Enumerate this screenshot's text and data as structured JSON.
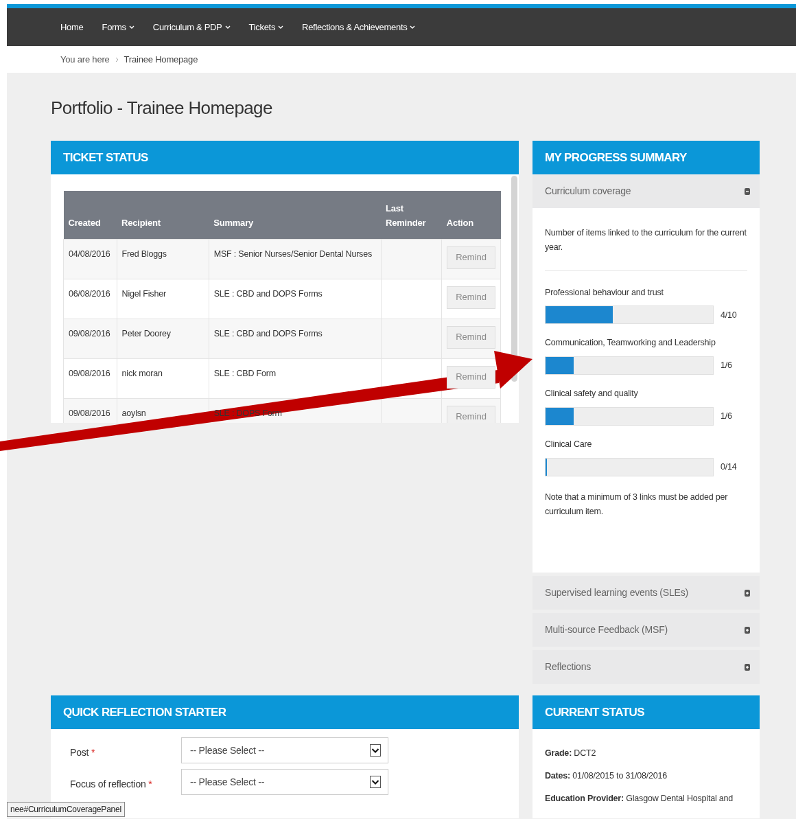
{
  "nav": {
    "items": [
      {
        "label": "Home",
        "dropdown": false
      },
      {
        "label": "Forms",
        "dropdown": true
      },
      {
        "label": "Curriculum & PDP",
        "dropdown": true
      },
      {
        "label": "Tickets",
        "dropdown": true
      },
      {
        "label": "Reflections & Achievements",
        "dropdown": true
      }
    ]
  },
  "breadcrumb": {
    "label": "You are here",
    "current": "Trainee Homepage"
  },
  "page_title": "Portfolio - Trainee Homepage",
  "ticket_status": {
    "title": "TICKET STATUS",
    "columns": [
      "Created",
      "Recipient",
      "Summary",
      "Last Reminder",
      "Action"
    ],
    "rows": [
      {
        "created": "04/08/2016",
        "recipient": "Fred Bloggs",
        "summary": "MSF : Senior Nurses/Senior Dental Nurses",
        "action": "Remind"
      },
      {
        "created": "06/08/2016",
        "recipient": "Nigel Fisher",
        "summary": "SLE : CBD and DOPS Forms",
        "action": "Remind"
      },
      {
        "created": "09/08/2016",
        "recipient": "Peter Doorey",
        "summary": "SLE : CBD and DOPS Forms",
        "action": "Remind"
      },
      {
        "created": "09/08/2016",
        "recipient": "nick moran",
        "summary": "SLE : CBD Form",
        "action": "Remind"
      },
      {
        "created": "09/08/2016",
        "recipient": "aoylsn",
        "summary": "SLE : DOPS Form",
        "action": "Remind"
      }
    ]
  },
  "progress_summary": {
    "title": "MY PROGRESS SUMMARY",
    "sections": [
      {
        "title": "Curriculum coverage",
        "expanded": true,
        "intro": "Number of items linked to the curriculum for the current year.",
        "items": [
          {
            "label": "Professional behaviour and trust",
            "level": 0.4,
            "reading": "4/10"
          },
          {
            "label": "Communication, Teamworking and Leadership",
            "level": 0.167,
            "reading": "1/6"
          },
          {
            "label": "Clinical safety and quality",
            "level": 0.167,
            "reading": "1/6"
          },
          {
            "label": "Clinical Care",
            "level": 0,
            "reading": "0/14"
          }
        ],
        "note": "Note that a minimum of 3 links must be added per curriculum item."
      },
      {
        "title": "Supervised learning events (SLEs)",
        "expanded": false
      },
      {
        "title": "Multi-source Feedback (MSF)",
        "expanded": false
      },
      {
        "title": "Reflections",
        "expanded": false
      }
    ]
  },
  "quick_reflection": {
    "title": "QUICK REFLECTION STARTER",
    "fields": [
      {
        "label": "Post",
        "required_mark": "*",
        "placeholder": "-- Please Select --"
      },
      {
        "label": "Focus of reflection",
        "required_mark": "*",
        "placeholder": "-- Please Select --"
      }
    ]
  },
  "current_status": {
    "title": "CURRENT STATUS",
    "entries": [
      {
        "label": "Grade:",
        "value": "DCT2"
      },
      {
        "label": "Dates:",
        "value": "01/08/2015 to 31/08/2016"
      },
      {
        "label": "Education Provider:",
        "value": "Glasgow Dental Hospital and"
      }
    ]
  },
  "status_bar": "nee#CurriculumCoveragePanel"
}
